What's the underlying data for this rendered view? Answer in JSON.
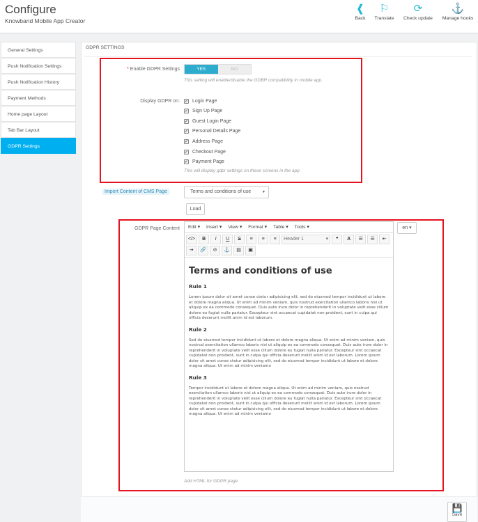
{
  "header": {
    "title": "Configure",
    "subtitle": "Knowband Mobile App Creator",
    "toolbar": [
      {
        "label": "Back",
        "icon": "back-icon"
      },
      {
        "label": "Translate",
        "icon": "flag-icon"
      },
      {
        "label": "Check update",
        "icon": "refresh-icon"
      },
      {
        "label": "Manage hooks",
        "icon": "anchor-icon"
      }
    ]
  },
  "sidebar": {
    "items": [
      {
        "label": "General Settings"
      },
      {
        "label": "Push Notification Settings"
      },
      {
        "label": "Push Notification History"
      },
      {
        "label": "Payment Methods"
      },
      {
        "label": "Home page Layout"
      },
      {
        "label": "Tab Bar Layout"
      },
      {
        "label": "GDPR Settings",
        "active": true
      }
    ]
  },
  "panel": {
    "heading": "GDPR SETTINGS",
    "enable": {
      "required": "*",
      "label": "Enable GDPR Settings",
      "yes": "YES",
      "no": "NO",
      "value": "YES",
      "help": "This setting will enable/disable the GDBR compatibility in mobile app."
    },
    "display": {
      "label": "Display GDPR on:",
      "options": [
        {
          "label": "Login Page",
          "checked": true
        },
        {
          "label": "Sign Up Page",
          "checked": true
        },
        {
          "label": "Guest Login Page",
          "checked": true
        },
        {
          "label": "Personal Details Page",
          "checked": true
        },
        {
          "label": "Address Page",
          "checked": true
        },
        {
          "label": "Checkout Page",
          "checked": true
        },
        {
          "label": "Payment Page",
          "checked": true
        }
      ],
      "help": "This will display gdpr settings on these screens in the app"
    },
    "import": {
      "label": "Import Content of CMS Page",
      "selected": "Terms and conditions of use",
      "load": "Load"
    },
    "content": {
      "label": "GDPR Page Content",
      "lang": "en",
      "help": "Add HTML for GDPR page",
      "menus": [
        "Edit",
        "Insert",
        "View",
        "Format",
        "Table",
        "Tools"
      ],
      "block_format": "Header 1",
      "doc": {
        "title": "Terms and conditions of use",
        "rules": [
          {
            "heading": "Rule 1",
            "text": "Lorem ipsum dolor sit amet conse ctetur adipisicing elit, sed do eiusmod tempor incididunt ut labore et dolore magna aliqua. Ut enim ad minim veniam, quis nostrud exercitation ullamco laboris nisi ut aliquip ex ea commodo consequat. Duis aute irure dolor in reprehenderit in voluptate velit esse cillum dolore eu fugiat nulla pariatur. Excepteur sint occaecat cupidatat non proident, sunt in culpa qui officia deserunt mollit anim id est laborum."
          },
          {
            "heading": "Rule 2",
            "text": "Sed do eiusmod tempor incididunt ut labore et dolore magna aliqua. Ut enim ad minim veniam, quis nostrud exercitation ullamco laboris nisi ut aliquip ex ea commodo consequat. Duis aute irure dolor in reprehenderit in voluptate velit esse cillum dolore eu fugiat nulla pariatur. Excepteur sint occaecat cupidatat non proident, sunt in culpa qui officia deserunt mollit anim id est laborum. Lorem ipsum dolor sit amet conse ctetur adipisicing elit, sed do eiusmod tempor incididunt ut labore et dolore magna aliqua. Ut enim ad minim veniamo"
          },
          {
            "heading": "Rule 3",
            "text": "Tempor incididunt ut labore et dolore magna aliqua. Ut enim ad minim veniam, quis nostrud exercitation ullamco laboris nisi ut aliquip ex ea commodo consequat. Duis aute irure dolor in reprehenderit in voluptate velit esse cillum dolore eu fugiat nulla pariatur. Excepteur sint occaecat cupidatat non proident, sunt in culpa qui officia deserunt mollit anim id est laborum. Lorem ipsum dolor sit amet conse ctetur adipisicing elit, sed do eiusmod tempor incididunt ut labore et dolore magna aliqua. Ut enim ad minim veniamo"
          }
        ]
      }
    },
    "save": "Save"
  },
  "colors": {
    "accent": "#25b9d7",
    "active": "#00aff0",
    "highlight": "#e5121f"
  }
}
